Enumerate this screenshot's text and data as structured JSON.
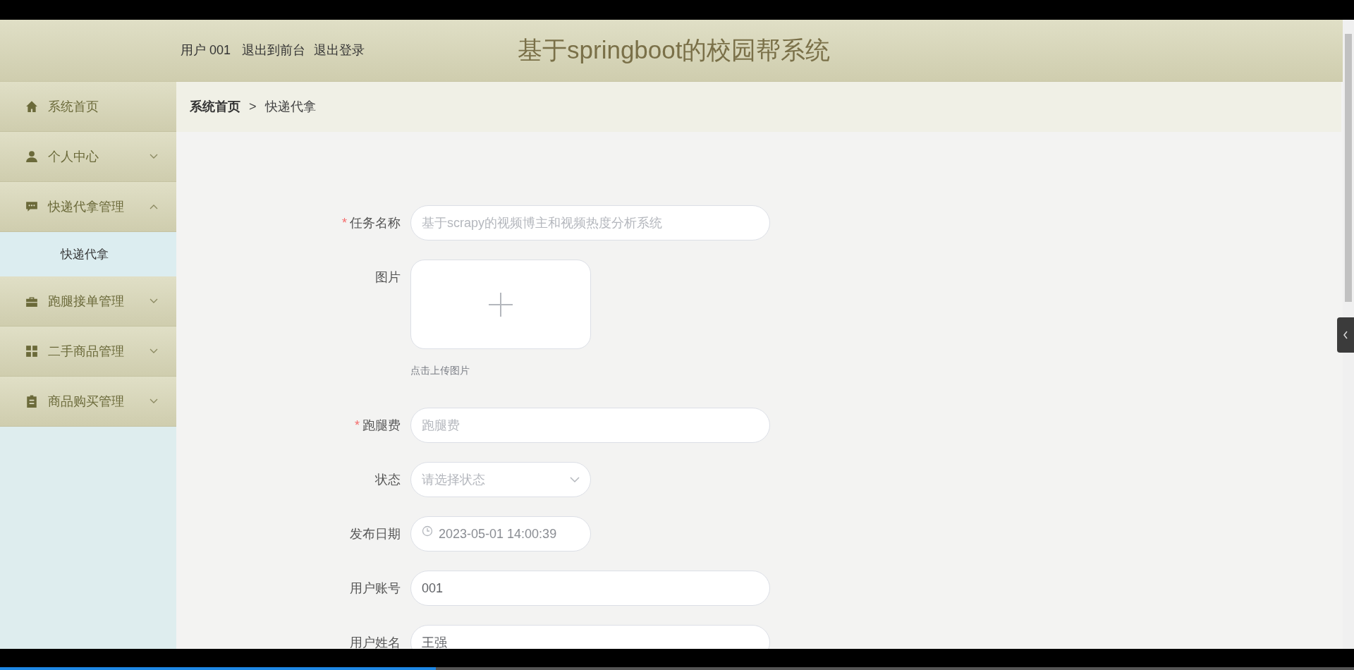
{
  "header": {
    "user_label": "用户 001",
    "links": [
      "退出到前台",
      "退出登录"
    ],
    "title": "基于springboot的校园帮系统"
  },
  "sidebar": {
    "items": [
      {
        "label": "系统首页",
        "has_caret": false
      },
      {
        "label": "个人中心",
        "expanded": false,
        "has_caret": true
      },
      {
        "label": "快递代拿管理",
        "expanded": true,
        "has_caret": true,
        "children": [
          {
            "label": "快递代拿",
            "selected": true
          }
        ]
      },
      {
        "label": "跑腿接单管理",
        "expanded": false,
        "has_caret": true
      },
      {
        "label": "二手商品管理",
        "expanded": false,
        "has_caret": true
      },
      {
        "label": "商品购买管理",
        "expanded": false,
        "has_caret": true
      }
    ]
  },
  "breadcrumb": {
    "items": [
      "系统首页",
      "快递代拿"
    ],
    "separator": ">"
  },
  "form": {
    "fields": [
      {
        "kind": "text",
        "label": "任务名称",
        "required_mark": "*",
        "placeholder": "基于scrapy的视频博主和视频热度分析系统",
        "wide": true
      },
      {
        "kind": "upload",
        "label": "图片",
        "hint": "点击上传图片"
      },
      {
        "kind": "text",
        "label": "跑腿费",
        "required_mark": "*",
        "placeholder": "跑腿费",
        "wide": true
      },
      {
        "kind": "select",
        "label": "状态",
        "placeholder": "请选择状态",
        "wide": false
      },
      {
        "kind": "date",
        "label": "发布日期",
        "value": "2023-05-01 14:00:39",
        "wide": false
      },
      {
        "kind": "text",
        "label": "用户账号",
        "value": "001",
        "wide": true
      },
      {
        "kind": "text",
        "label": "用户姓名",
        "value": "王强",
        "wide": true
      }
    ]
  },
  "video_player": {
    "progress": {
      "level": 0.322
    }
  }
}
